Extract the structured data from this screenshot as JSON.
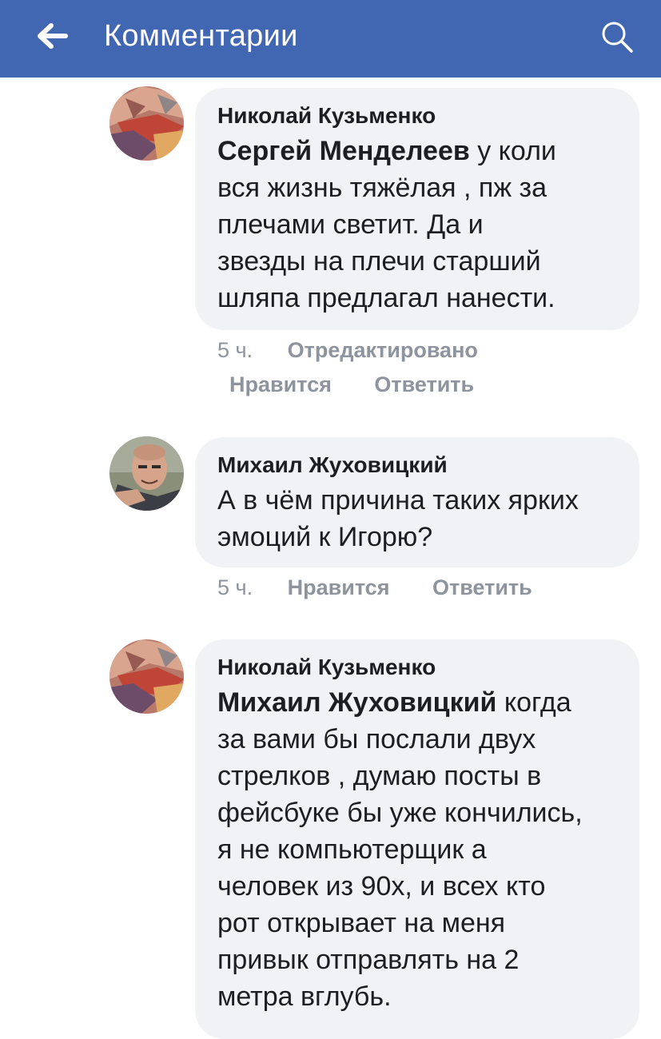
{
  "header": {
    "title": "Комментарии",
    "background": "#4267b2",
    "back_icon": "arrow-left-icon",
    "search_icon": "search-icon"
  },
  "comments": [
    {
      "author": "Николай Кузьменко",
      "mention": "Сергей Менделеев",
      "lines": [
        " у коли",
        "вся жизнь тяжёлая , пж за",
        "плечами светит. Да и",
        "звезды на плечи старший",
        "шляпа предлагал нанести."
      ],
      "time": "5 ч.",
      "edited": "Отредактировано",
      "like": "Нравится",
      "reply": "Ответить"
    },
    {
      "author": "Михаил Жуховицкий",
      "lines": [
        "А в чём причина таких ярких",
        "эмоций к Игорю?"
      ],
      "time": "5 ч.",
      "like": "Нравится",
      "reply": "Ответить"
    },
    {
      "author": "Николай Кузьменко",
      "mention": "Михаил Жуховицкий",
      "lines": [
        " когда",
        "за вами бы послали двух",
        "стрелков , думаю посты в",
        "фейсбуке бы уже кончились,",
        "я не компьютерщик а",
        "человек из 90х, и всех кто",
        "рот открывает на меня",
        "привык отправлять на 2",
        "метра вглубь."
      ]
    }
  ]
}
